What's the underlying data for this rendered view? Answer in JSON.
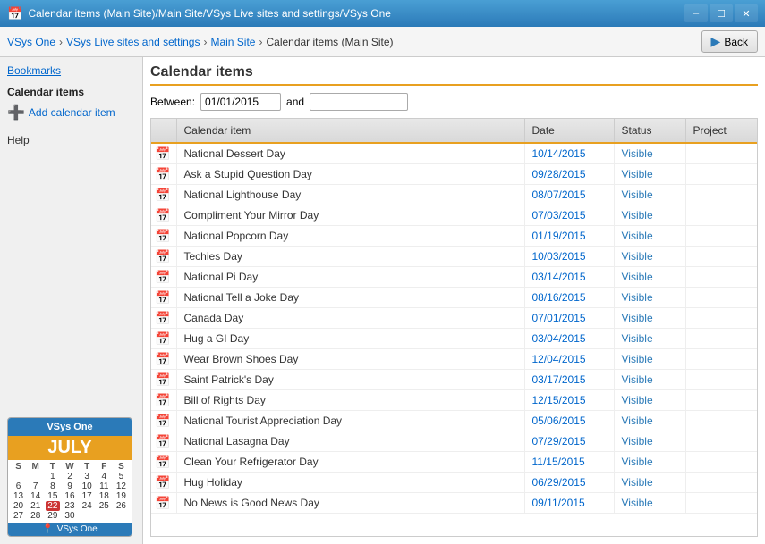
{
  "titleBar": {
    "text": "Calendar items (Main Site)/Main Site/VSys Live sites and settings/VSys One",
    "controls": [
      "minimize",
      "maximize",
      "close"
    ]
  },
  "breadcrumb": {
    "items": [
      "VSys One",
      "VSys Live sites and settings",
      "Main Site"
    ],
    "current": "Calendar items (Main Site)"
  },
  "backButton": {
    "label": "Back"
  },
  "sidebar": {
    "bookmarks": "Bookmarks",
    "sectionTitle": "Calendar items",
    "addLabel": "Add calendar item",
    "helpLabel": "Help"
  },
  "calWidget": {
    "title": "VSys One",
    "month": "JULY",
    "dayHeaders": [
      "S",
      "M",
      "T",
      "W",
      "T",
      "F",
      "S"
    ],
    "weeks": [
      [
        "",
        "",
        "1",
        "2",
        "3",
        "4",
        "5"
      ],
      [
        "6",
        "7",
        "8",
        "9",
        "10",
        "11",
        "12"
      ],
      [
        "13",
        "14",
        "15",
        "16",
        "17",
        "18",
        "19"
      ],
      [
        "20",
        "21",
        "22",
        "23",
        "24",
        "25",
        "26"
      ],
      [
        "27",
        "28",
        "29",
        "30",
        "",
        "",
        ""
      ]
    ],
    "highlightDay": "22"
  },
  "main": {
    "title": "Calendar items",
    "between_label": "Between:",
    "from_date": "01/01/2015",
    "and_label": "and",
    "to_date": "",
    "columns": [
      "Calendar item",
      "Date",
      "Status",
      "Project"
    ],
    "rows": [
      {
        "name": "National Dessert Day",
        "date": "10/14/2015",
        "status": "Visible"
      },
      {
        "name": "Ask a Stupid Question Day",
        "date": "09/28/2015",
        "status": "Visible"
      },
      {
        "name": "National Lighthouse Day",
        "date": "08/07/2015",
        "status": "Visible"
      },
      {
        "name": "Compliment Your Mirror Day",
        "date": "07/03/2015",
        "status": "Visible"
      },
      {
        "name": "National Popcorn Day",
        "date": "01/19/2015",
        "status": "Visible"
      },
      {
        "name": "Techies Day",
        "date": "10/03/2015",
        "status": "Visible"
      },
      {
        "name": "National Pi Day",
        "date": "03/14/2015",
        "status": "Visible"
      },
      {
        "name": "National Tell a Joke Day",
        "date": "08/16/2015",
        "status": "Visible"
      },
      {
        "name": "Canada Day",
        "date": "07/01/2015",
        "status": "Visible"
      },
      {
        "name": "Hug a GI Day",
        "date": "03/04/2015",
        "status": "Visible"
      },
      {
        "name": "Wear Brown Shoes Day",
        "date": "12/04/2015",
        "status": "Visible"
      },
      {
        "name": "Saint Patrick's Day",
        "date": "03/17/2015",
        "status": "Visible"
      },
      {
        "name": "Bill of Rights Day",
        "date": "12/15/2015",
        "status": "Visible"
      },
      {
        "name": "National Tourist Appreciation Day",
        "date": "05/06/2015",
        "status": "Visible"
      },
      {
        "name": "National Lasagna Day",
        "date": "07/29/2015",
        "status": "Visible"
      },
      {
        "name": "Clean Your Refrigerator Day",
        "date": "11/15/2015",
        "status": "Visible"
      },
      {
        "name": "Hug Holiday",
        "date": "06/29/2015",
        "status": "Visible"
      },
      {
        "name": "No News is Good News Day",
        "date": "09/11/2015",
        "status": "Visible"
      }
    ]
  }
}
